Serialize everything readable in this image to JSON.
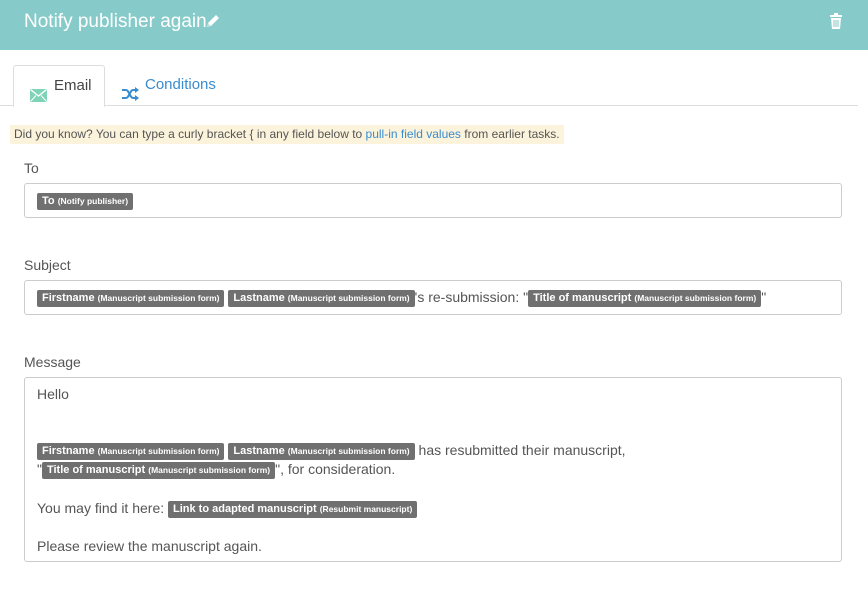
{
  "header": {
    "title": "Notify publisher again",
    "edit_icon": "pencil-icon",
    "delete_icon": "trash-icon"
  },
  "tabs": [
    {
      "label": "Email",
      "icon": "envelope-icon"
    },
    {
      "label": "Conditions",
      "icon": "shuffle-icon"
    }
  ],
  "tip": {
    "prefix": "Did you know? You can type a curly bracket { in any field below to ",
    "link": "pull-in field values",
    "suffix": " from earlier tasks."
  },
  "to": {
    "label": "To",
    "tokens": [
      {
        "name": "To",
        "source": "(Notify publisher)"
      }
    ]
  },
  "subject": {
    "label": "Subject",
    "token_firstname": {
      "name": "Firstname",
      "source": "(Manuscript submission form)"
    },
    "token_lastname": {
      "name": "Lastname",
      "source": "(Manuscript submission form)"
    },
    "text_1": "'s re-submission: \"",
    "token_title": {
      "name": "Title of manuscript",
      "source": "(Manuscript submission form)"
    },
    "text_2": "\""
  },
  "message": {
    "label": "Message",
    "greeting": "Hello",
    "token_firstname": {
      "name": "Firstname",
      "source": "(Manuscript submission form)"
    },
    "token_lastname": {
      "name": "Lastname",
      "source": "(Manuscript submission form)"
    },
    "text_resubmitted": " has resubmitted their manuscript,",
    "quote_open": "\"",
    "token_title": {
      "name": "Title of manuscript",
      "source": "(Manuscript submission form)"
    },
    "text_consideration": "\", for consideration.",
    "text_find": "You may find it here: ",
    "token_link": {
      "name": "Link to adapted manuscript",
      "source": "(Resubmit manuscript)"
    },
    "text_review": "Please review the manuscript again."
  },
  "colors": {
    "header_bg": "#86cbc9",
    "link": "#3a8cd0",
    "pill_bg": "#707070",
    "tip_bg": "#fbf3dc"
  }
}
